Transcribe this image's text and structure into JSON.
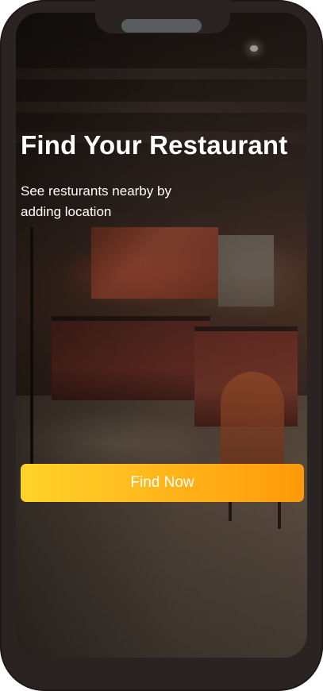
{
  "screen": {
    "title": "Find Your Restaurant",
    "subtitle": "See resturants nearby by adding location",
    "cta_label": "Find Now"
  },
  "colors": {
    "cta_gradient_start": "#ffd32a",
    "cta_gradient_end": "#ff9a0a",
    "phone_frame": "#2b2322",
    "text": "#ffffff"
  },
  "background_image": "restaurant-interior-photo"
}
